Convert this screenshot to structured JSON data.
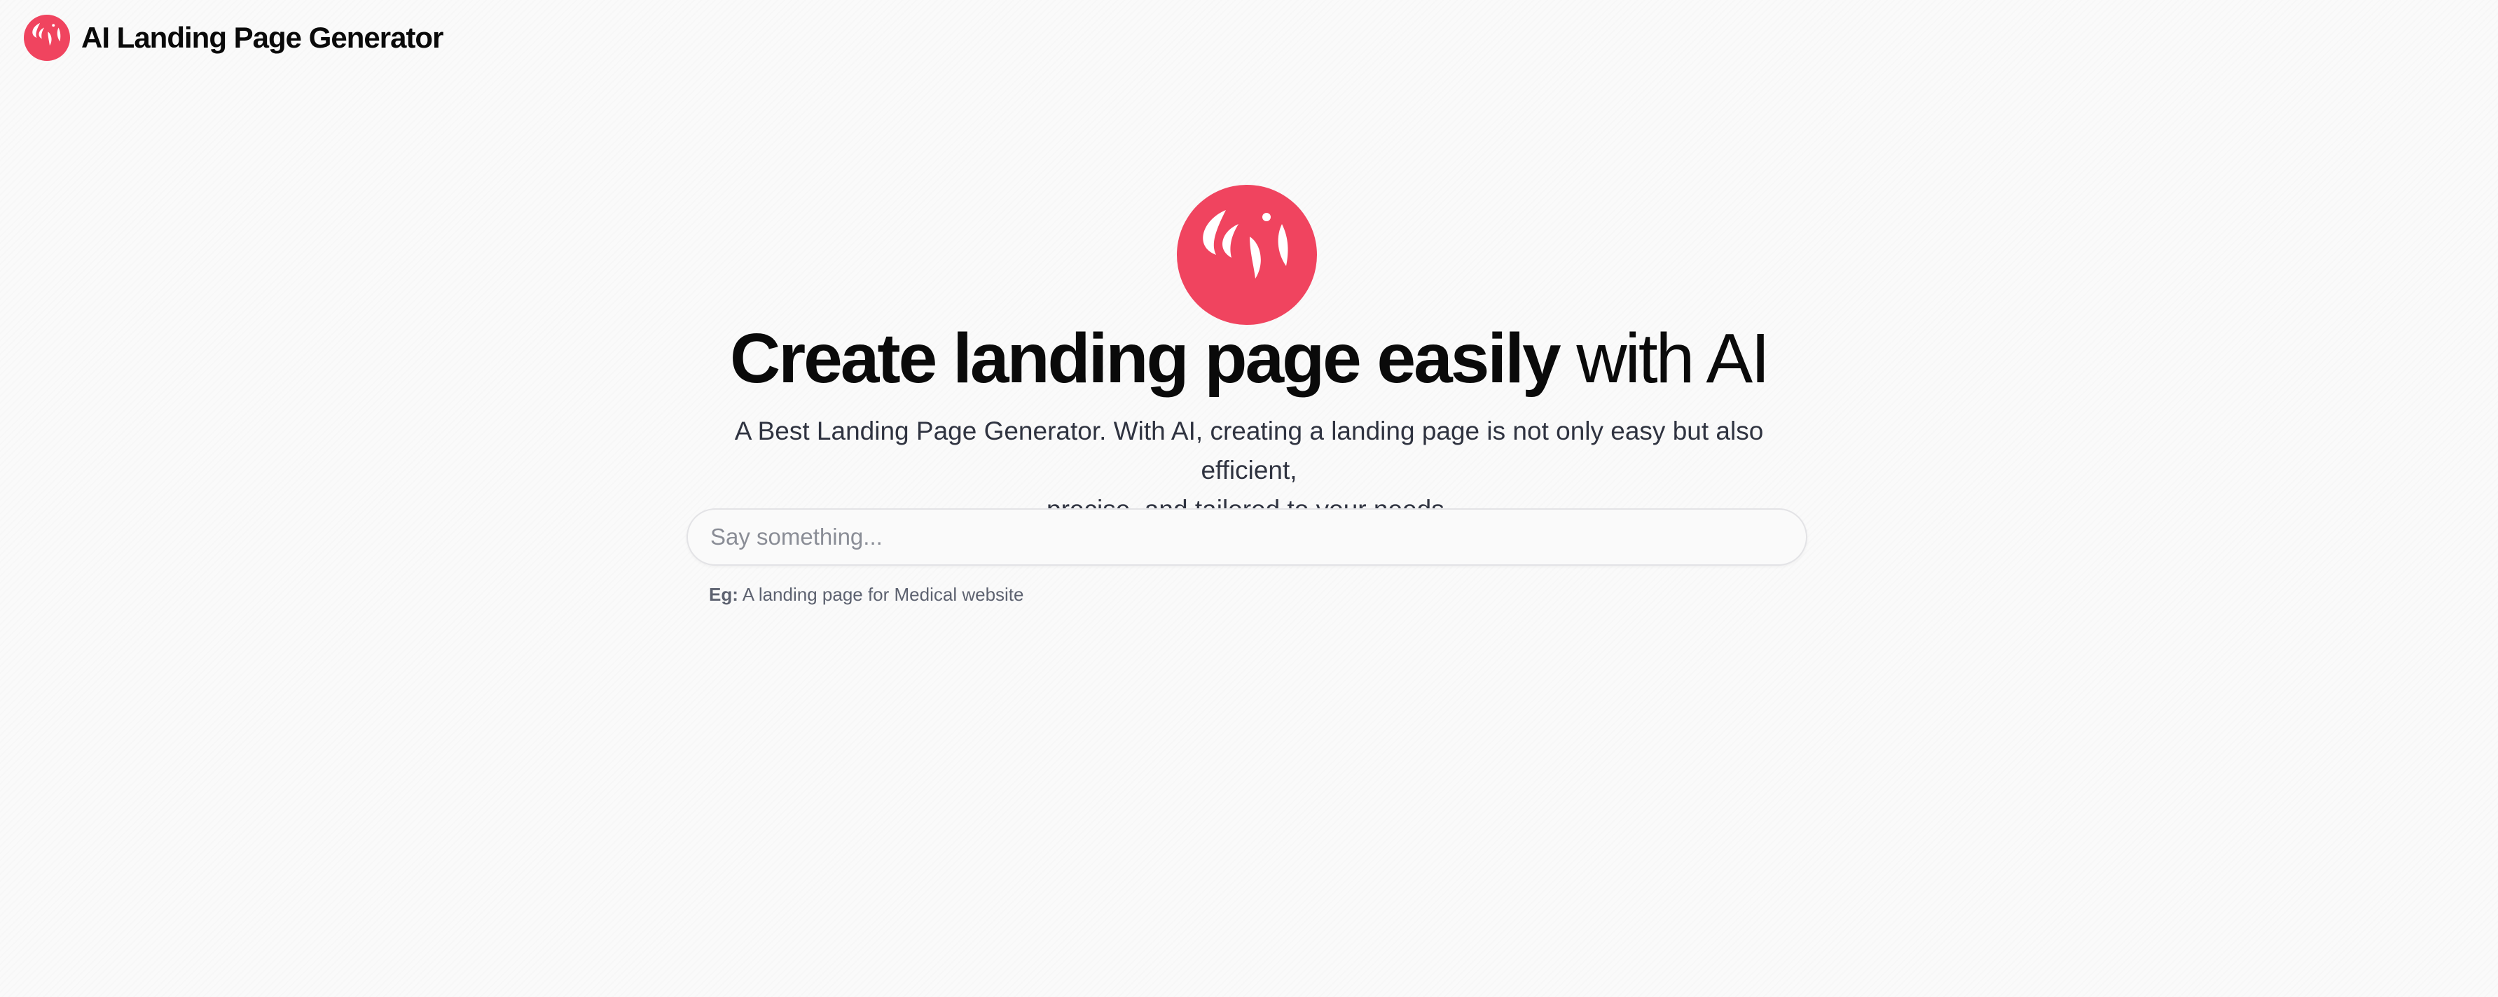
{
  "header": {
    "app_name": "AI Landing Page Generator",
    "logo_icon": "phoenix-icon"
  },
  "hero": {
    "logo_icon": "phoenix-icon",
    "headline_bold": "Create landing page easily",
    "headline_light": "with AI",
    "subtitle_line1": "A Best Landing Page Generator. With AI, creating a landing page is not only easy but also efficient,",
    "subtitle_line2": "precise, and tailored to your needs."
  },
  "prompt": {
    "value": "",
    "placeholder": "Say something..."
  },
  "example": {
    "label": "Eg:",
    "text": "A landing page for Medical website"
  },
  "colors": {
    "brand": "#f0445f",
    "background": "#fafafa",
    "text": "#0a0a0a"
  }
}
